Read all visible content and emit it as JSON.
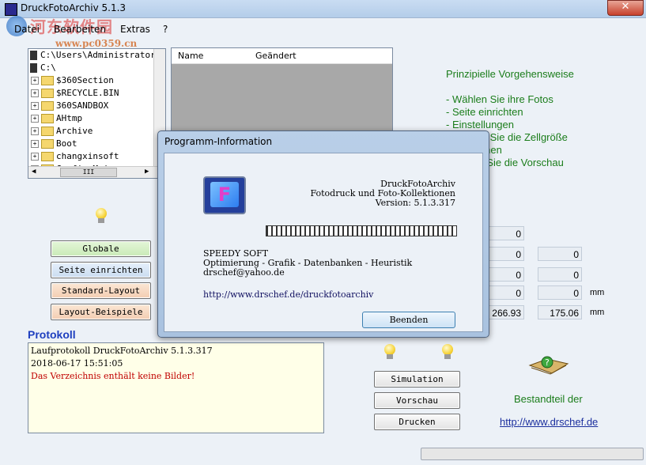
{
  "window": {
    "title": "DruckFotoArchiv  5.1.3",
    "close_glyph": "✕"
  },
  "watermark": {
    "site": "河东软件园",
    "url": "www.pc0359.cn"
  },
  "menu": [
    {
      "label": "Datei"
    },
    {
      "label": "Bearbeiten"
    },
    {
      "label": "Extras"
    },
    {
      "label": "?"
    }
  ],
  "tree": {
    "path_row": "C:\\Users\\Administrator\\",
    "drive_row": "C:\\",
    "items": [
      "$360Section",
      "$RECYCLE.BIN",
      "360SANDBOX",
      "AHtmp",
      "Archive",
      "Boot",
      "changxinsoft",
      "Config.Msi"
    ],
    "hscroll_grip": "III"
  },
  "listview": {
    "col_name": "Name",
    "col_changed": "Geändert"
  },
  "right_panel": {
    "heading": "Prinzipielle Vorgehensweise",
    "steps": [
      "- Wählen Sie ihre Fotos",
      "- Seite einrichten",
      "- Einstellungen",
      "- Wählen Sie die Zellgröße",
      "- Berechnen",
      "- Zeigen Sie die Vorschau"
    ]
  },
  "settings_values": {
    "col1": [
      "0",
      "0",
      "0",
      "0",
      "266.93"
    ],
    "col2": [
      "0",
      "0",
      "0",
      "175.06"
    ],
    "unit1": "mm",
    "unit2": "mm"
  },
  "left_buttons": {
    "globale": "Globale",
    "seite": "Seite einrichten",
    "standard": "Standard-Layout",
    "beispiele": "Layout-Beispiele"
  },
  "protokoll": {
    "title": "Protokoll",
    "lines": [
      "Laufprotokoll DruckFotoArchiv 5.1.3.317",
      "2018-06-17 15:51:05",
      "Das Verzeichnis enthält keine Bilder!"
    ],
    "error_color": "#c00000"
  },
  "action_buttons": {
    "simulation": "Simulation",
    "vorschau": "Vorschau",
    "drucken": "Drucken"
  },
  "branding": {
    "text": "Bestandteil der",
    "link": "http://www.drschef.de"
  },
  "dialog": {
    "title": "Programm-Information",
    "app_name": "DruckFotoArchiv",
    "subtitle": "Fotodruck und Foto-Kollektionen",
    "version": "Version: 5.1.3.317",
    "company": "SPEEDY SOFT",
    "tagline": "Optimierung - Grafik - Datenbanken - Heuristik",
    "email": "drschef@yahoo.de",
    "url": "http://www.drschef.de/druckfotoarchiv",
    "ok_label": "Beenden"
  }
}
